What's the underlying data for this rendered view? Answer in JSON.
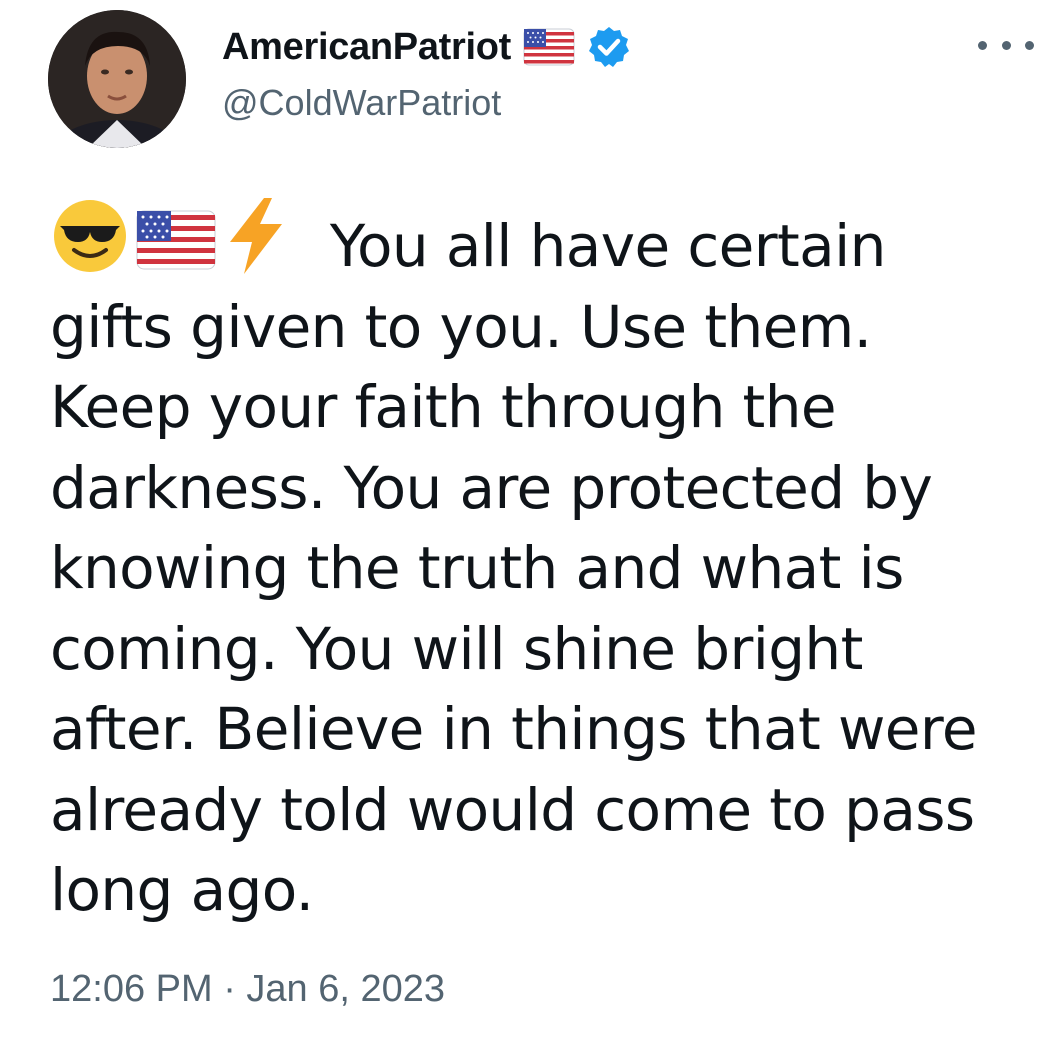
{
  "user": {
    "display_name": "AmericanPatriot",
    "handle": "@ColdWarPatriot",
    "verified": true,
    "avatar_icon": "profile-photo",
    "name_badge_icon": "us-flag-emoji"
  },
  "tweet": {
    "leading_emojis": [
      "smiling-face-with-sunglasses-emoji",
      "us-flag-emoji",
      "high-voltage-emoji"
    ],
    "lines": [
      " You all have certain",
      "gifts given to you. Use them.",
      "Keep your faith through the",
      "darkness. You are protected by",
      "knowing the truth and what is",
      "coming. You will shine bright",
      "after. Believe in things that were",
      "already told would come to pass",
      "long ago."
    ],
    "timestamp": "12:06 PM · Jan 6, 2023"
  },
  "menu": {
    "icon": "more-options-icon"
  },
  "colors": {
    "text": "#0f1419",
    "secondary": "#536471",
    "verified_blue": "#1d9bf0",
    "background": "#ffffff"
  }
}
